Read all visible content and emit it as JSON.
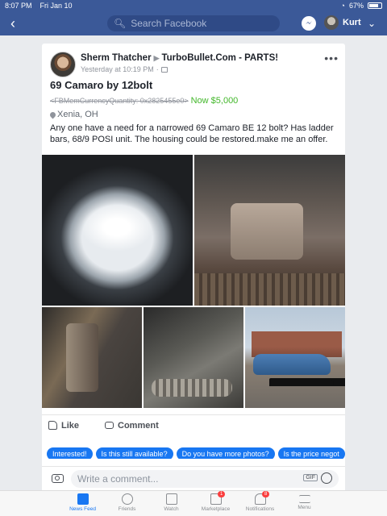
{
  "status": {
    "time": "8:07 PM",
    "date": "Fri Jan 10",
    "battery": "67%"
  },
  "nav": {
    "search_placeholder": "Search Facebook",
    "profile_name": "Kurt"
  },
  "post": {
    "author": "Sherm Thatcher",
    "group": "TurboBullet.Com - PARTS!",
    "timestamp": "Yesterday at 10:19 PM",
    "title": "69 Camaro by 12bolt",
    "old_price": "<FBMemCurrencyQuantity: 0x2825455e0>",
    "new_price": "Now $5,000",
    "location": "Xenia, OH",
    "body": "Any one have a need for a narrowed 69 Camaro BE 12 bolt?  Has ladder bars, 68/9 POSI unit. The housing could be restored.make me an offer."
  },
  "actions": {
    "like": "Like",
    "comment": "Comment"
  },
  "quick_replies": [
    "Interested!",
    "Is this still available?",
    "Do you have more photos?",
    "Is the price negot"
  ],
  "composer": {
    "placeholder": "Write a comment...",
    "gif": "GIF"
  },
  "tabs": [
    {
      "label": "News Feed",
      "icon": "news-feed-icon",
      "active": true
    },
    {
      "label": "Friends",
      "icon": "friends-icon"
    },
    {
      "label": "Watch",
      "icon": "watch-icon"
    },
    {
      "label": "Marketplace",
      "icon": "marketplace-icon",
      "badge": "1"
    },
    {
      "label": "Notifications",
      "icon": "bell-icon",
      "badge": "8"
    },
    {
      "label": "Menu",
      "icon": "hamburger-icon"
    }
  ],
  "colors": {
    "brand": "#3b5998",
    "accent": "#1877f2",
    "price_green": "#42b72a"
  }
}
